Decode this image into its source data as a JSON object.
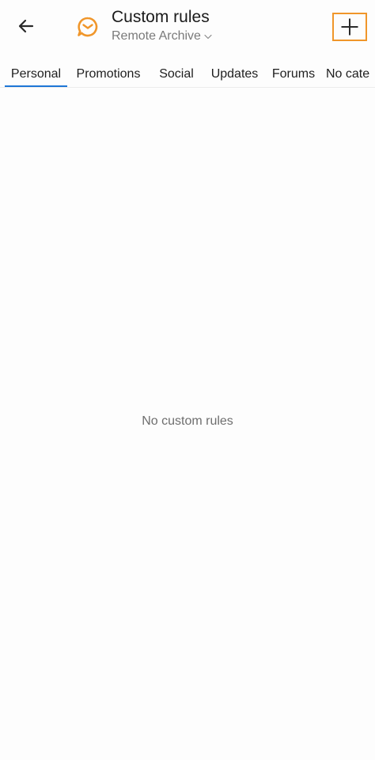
{
  "header": {
    "title": "Custom rules",
    "account": "Remote Archive",
    "back_icon": "arrow-left-icon",
    "logo_icon": "app-logo-icon",
    "add_icon": "plus-icon",
    "accent_color": "#f0962a"
  },
  "tabs": [
    {
      "label": "Personal",
      "active": true
    },
    {
      "label": "Promotions",
      "active": false
    },
    {
      "label": "Social",
      "active": false
    },
    {
      "label": "Updates",
      "active": false
    },
    {
      "label": "Forums",
      "active": false
    },
    {
      "label": "No cate",
      "active": false
    }
  ],
  "tab_indicator_color": "#1e76d6",
  "empty_state": {
    "message": "No custom rules"
  }
}
